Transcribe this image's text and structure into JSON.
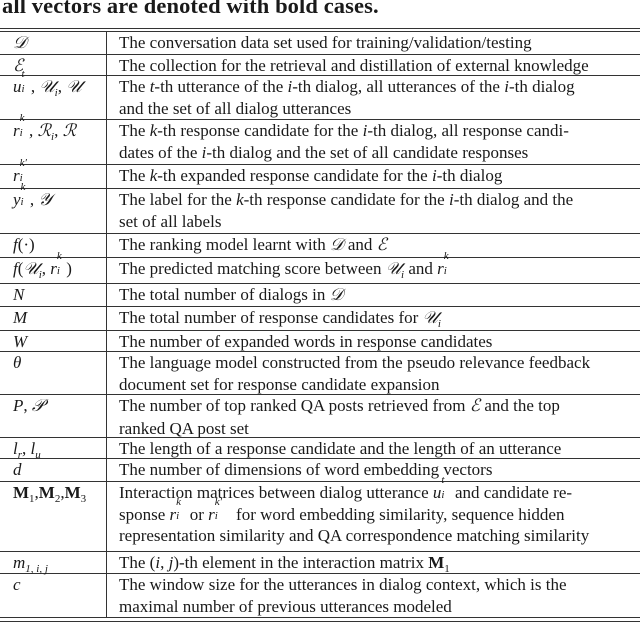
{
  "caption": "all vectors are denoted with bold cases.",
  "table": {
    "rows": [
      {
        "symbol": [
          {
            "t": "cal",
            "v": "D"
          }
        ],
        "height": 23,
        "lines": [
          [
            {
              "t": "text",
              "v": "The conversation data set used for training/validation/testing"
            }
          ]
        ]
      },
      {
        "symbol": [
          {
            "t": "cal",
            "v": "E"
          }
        ],
        "height": 21,
        "lines": [
          [
            {
              "t": "text",
              "v": "The collection for the retrieval and distillation of external knowledge"
            }
          ]
        ]
      },
      {
        "symbol": [
          {
            "t": "var",
            "v": "u",
            "sup": "t",
            "sub": "i"
          },
          {
            "t": "text",
            "v": ", "
          },
          {
            "t": "cal",
            "v": "U",
            "sub": "i"
          },
          {
            "t": "text",
            "v": ", "
          },
          {
            "t": "cal",
            "v": "U"
          }
        ],
        "height": 44,
        "lines": [
          [
            {
              "t": "text",
              "v": "The "
            },
            {
              "t": "var",
              "v": "t"
            },
            {
              "t": "text",
              "v": "-th utterance of the "
            },
            {
              "t": "var",
              "v": "i"
            },
            {
              "t": "text",
              "v": "-th dialog, all utterances of the "
            },
            {
              "t": "var",
              "v": "i"
            },
            {
              "t": "text",
              "v": "-th dialog"
            }
          ],
          [
            {
              "t": "text",
              "v": "and the set of all dialog utterances"
            }
          ]
        ]
      },
      {
        "symbol": [
          {
            "t": "var",
            "v": "r",
            "sup": "k",
            "sub": "i"
          },
          {
            "t": "text",
            "v": ", "
          },
          {
            "t": "cal",
            "v": "R",
            "sub": "i"
          },
          {
            "t": "text",
            "v": ", "
          },
          {
            "t": "cal",
            "v": "R"
          }
        ],
        "height": 45,
        "lines": [
          [
            {
              "t": "text",
              "v": "The "
            },
            {
              "t": "var",
              "v": "k"
            },
            {
              "t": "text",
              "v": "-th response candidate for the "
            },
            {
              "t": "var",
              "v": "i"
            },
            {
              "t": "text",
              "v": "-th dialog, all response candi-"
            }
          ],
          [
            {
              "t": "text",
              "v": "dates of the "
            },
            {
              "t": "var",
              "v": "i"
            },
            {
              "t": "text",
              "v": "-th dialog and the set of all candidate responses"
            }
          ]
        ]
      },
      {
        "symbol": [
          {
            "t": "var",
            "v": "r",
            "sup": "k′",
            "sub": "i"
          }
        ],
        "height": 24,
        "lines": [
          [
            {
              "t": "text",
              "v": "The "
            },
            {
              "t": "var",
              "v": "k"
            },
            {
              "t": "text",
              "v": "-th expanded response candidate for the "
            },
            {
              "t": "var",
              "v": "i"
            },
            {
              "t": "text",
              "v": "-th dialog"
            }
          ]
        ]
      },
      {
        "symbol": [
          {
            "t": "var",
            "v": "y",
            "sup": "k",
            "sub": "i"
          },
          {
            "t": "text",
            "v": ", "
          },
          {
            "t": "cal",
            "v": "Y"
          }
        ],
        "height": 45,
        "lines": [
          [
            {
              "t": "text",
              "v": "The label for the "
            },
            {
              "t": "var",
              "v": "k"
            },
            {
              "t": "text",
              "v": "-th response candidate for the "
            },
            {
              "t": "var",
              "v": "i"
            },
            {
              "t": "text",
              "v": "-th dialog and the"
            }
          ],
          [
            {
              "t": "text",
              "v": "set of all labels"
            }
          ]
        ]
      },
      {
        "symbol": [
          {
            "t": "var",
            "v": "f"
          },
          {
            "t": "text",
            "v": "(·)"
          }
        ],
        "height": 24,
        "lines": [
          [
            {
              "t": "text",
              "v": "The ranking model learnt with "
            },
            {
              "t": "cal",
              "v": "D"
            },
            {
              "t": "text",
              "v": " and "
            },
            {
              "t": "cal",
              "v": "E"
            }
          ]
        ]
      },
      {
        "symbol": [
          {
            "t": "var",
            "v": "f"
          },
          {
            "t": "text",
            "v": "("
          },
          {
            "t": "cal",
            "v": "U",
            "sub": "i"
          },
          {
            "t": "text",
            "v": ", "
          },
          {
            "t": "var",
            "v": "r",
            "sup": "k",
            "sub": "i"
          },
          {
            "t": "text",
            "v": ")"
          }
        ],
        "height": 26,
        "lines": [
          [
            {
              "t": "text",
              "v": "The predicted matching score between "
            },
            {
              "t": "cal",
              "v": "U",
              "sub": "i"
            },
            {
              "t": "text",
              "v": " and "
            },
            {
              "t": "var",
              "v": "r",
              "sup": "k",
              "sub": "i"
            }
          ]
        ]
      },
      {
        "symbol": [
          {
            "t": "var",
            "v": "N"
          }
        ],
        "height": 23,
        "lines": [
          [
            {
              "t": "text",
              "v": "The total number of dialogs in "
            },
            {
              "t": "cal",
              "v": "D"
            }
          ]
        ]
      },
      {
        "symbol": [
          {
            "t": "var",
            "v": "M"
          }
        ],
        "height": 24,
        "lines": [
          [
            {
              "t": "text",
              "v": "The total number of response candidates for "
            },
            {
              "t": "cal",
              "v": "U",
              "sub": "i"
            }
          ]
        ]
      },
      {
        "symbol": [
          {
            "t": "var",
            "v": "W"
          }
        ],
        "height": 21,
        "lines": [
          [
            {
              "t": "text",
              "v": "The number of expanded words in response candidates"
            }
          ]
        ]
      },
      {
        "symbol": [
          {
            "t": "var",
            "v": "θ"
          }
        ],
        "height": 43,
        "lines": [
          [
            {
              "t": "text",
              "v": "The language model constructed from the pseudo relevance feedback"
            }
          ],
          [
            {
              "t": "text",
              "v": "document set for response candidate expansion"
            }
          ]
        ]
      },
      {
        "symbol": [
          {
            "t": "var",
            "v": "P"
          },
          {
            "t": "text",
            "v": ", "
          },
          {
            "t": "cal",
            "v": "P"
          }
        ],
        "height": 43,
        "lines": [
          [
            {
              "t": "text",
              "v": "The number of top ranked QA posts retrieved from "
            },
            {
              "t": "cal",
              "v": "E"
            },
            {
              "t": "text",
              "v": " and the top"
            }
          ],
          [
            {
              "t": "text",
              "v": "ranked QA post set"
            }
          ]
        ]
      },
      {
        "symbol": [
          {
            "t": "var",
            "v": "l",
            "sub": "r"
          },
          {
            "t": "text",
            "v": ", "
          },
          {
            "t": "var",
            "v": "l",
            "sub": "u"
          }
        ],
        "height": 21,
        "lines": [
          [
            {
              "t": "text",
              "v": "The length of a response candidate and the length of an utterance"
            }
          ]
        ]
      },
      {
        "symbol": [
          {
            "t": "var",
            "v": "d"
          }
        ],
        "height": 23,
        "lines": [
          [
            {
              "t": "text",
              "v": "The number of dimensions of word embedding vectors"
            }
          ]
        ]
      },
      {
        "symbol": [
          {
            "t": "bf",
            "v": "M",
            "sub": "1"
          },
          {
            "t": "text",
            "v": ","
          },
          {
            "t": "bf",
            "v": "M",
            "sub": "2"
          },
          {
            "t": "text",
            "v": ","
          },
          {
            "t": "bf",
            "v": "M",
            "sub": "3"
          }
        ],
        "height": 70,
        "lines": [
          [
            {
              "t": "text",
              "v": "Interaction matrices between dialog utterance "
            },
            {
              "t": "var",
              "v": "u",
              "sup": "t",
              "sub": "i"
            },
            {
              "t": "text",
              "v": " and candidate re-"
            }
          ],
          [
            {
              "t": "text",
              "v": "sponse "
            },
            {
              "t": "var",
              "v": "r",
              "sup": "k",
              "sub": "i"
            },
            {
              "t": "text",
              "v": " or "
            },
            {
              "t": "var",
              "v": "r",
              "sup": "k′",
              "sub": "i"
            },
            {
              "t": "text",
              "v": " for word embedding similarity, sequence hidden"
            }
          ],
          [
            {
              "t": "text",
              "v": "representation similarity and QA correspondence matching similarity"
            }
          ]
        ]
      },
      {
        "symbol": [
          {
            "t": "var",
            "v": "m",
            "sub": "1, i, j"
          }
        ],
        "height": 22,
        "lines": [
          [
            {
              "t": "text",
              "v": "The ("
            },
            {
              "t": "var",
              "v": "i"
            },
            {
              "t": "text",
              "v": ", "
            },
            {
              "t": "var",
              "v": "j"
            },
            {
              "t": "text",
              "v": ")-th element in the interaction matrix "
            },
            {
              "t": "bf",
              "v": "M",
              "sub": "1"
            }
          ]
        ]
      },
      {
        "symbol": [
          {
            "t": "var",
            "v": "c"
          }
        ],
        "height": 44,
        "lines": [
          [
            {
              "t": "text",
              "v": "The window size for the utterances in dialog context, which is the"
            }
          ],
          [
            {
              "t": "text",
              "v": "maximal number of previous utterances modeled"
            }
          ]
        ]
      }
    ]
  }
}
